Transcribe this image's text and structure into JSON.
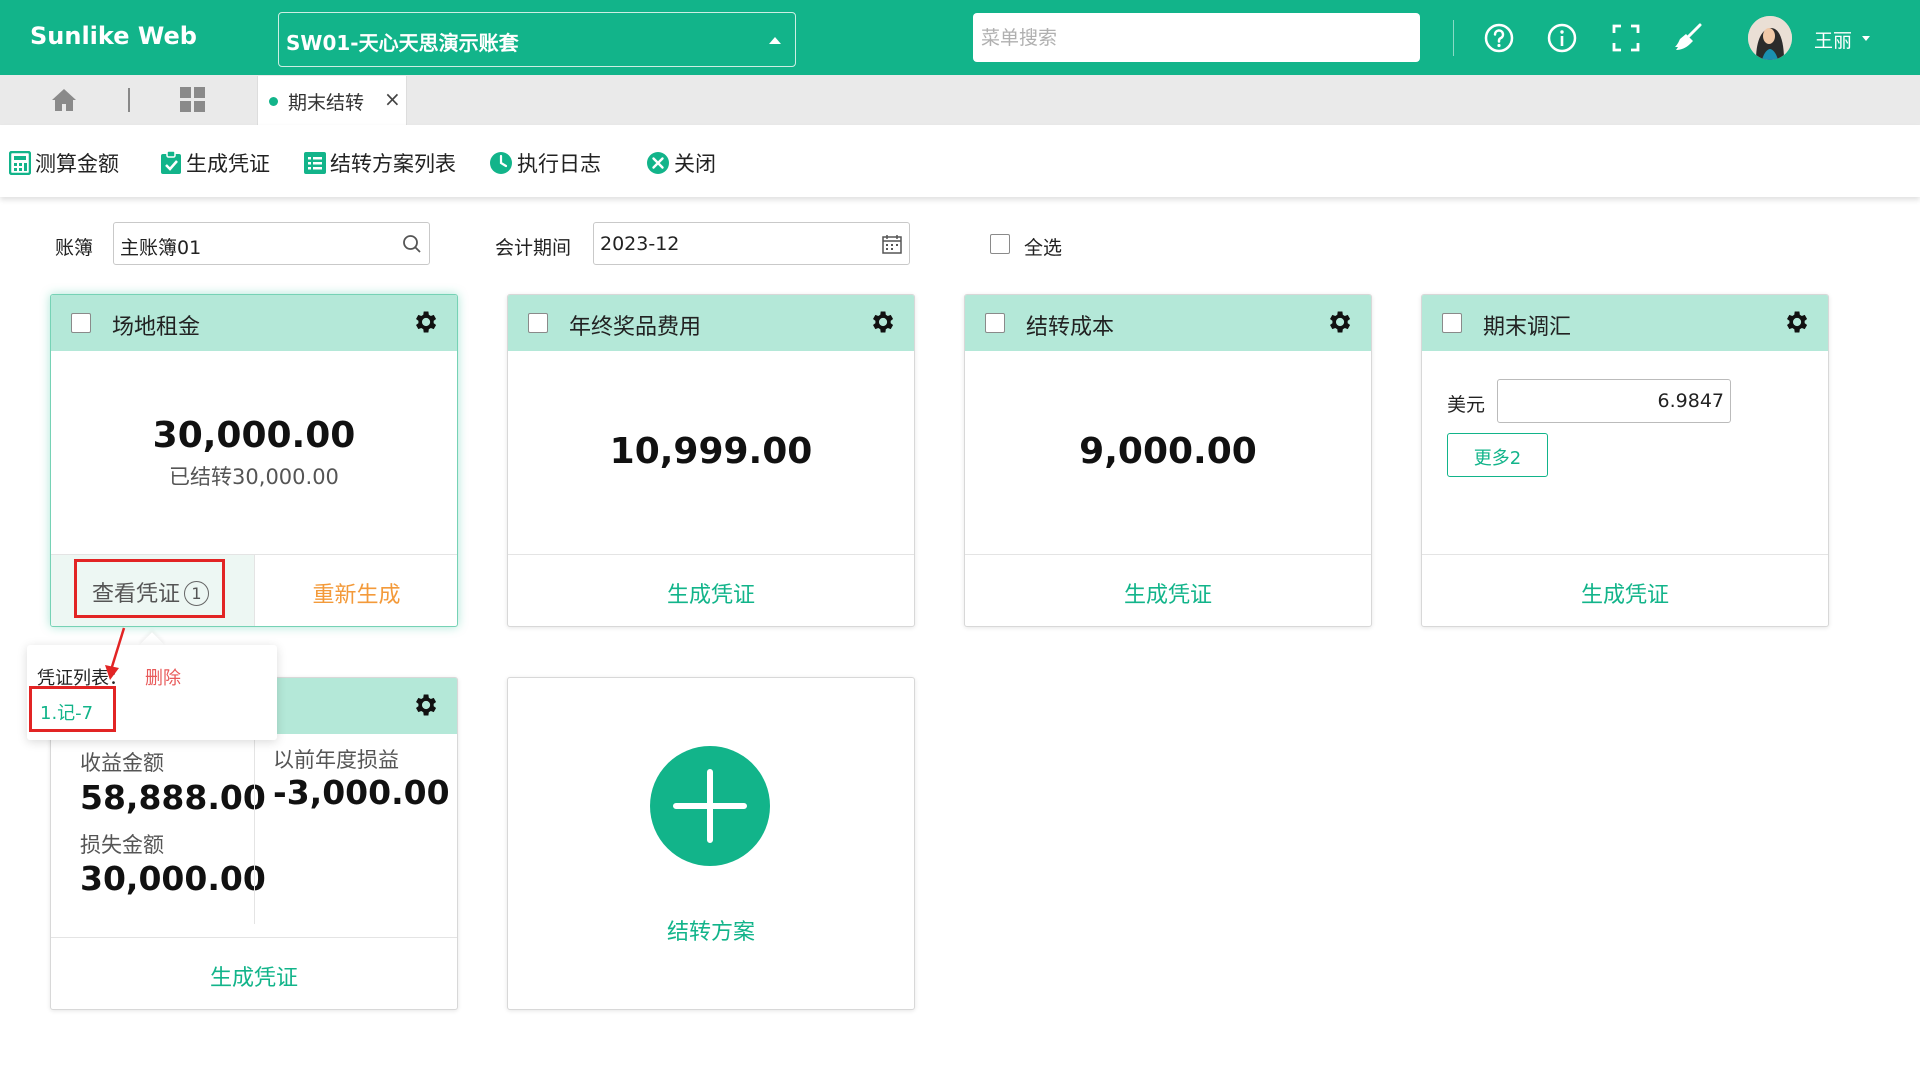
{
  "app": {
    "title": "Sunlike Web"
  },
  "header": {
    "account_set": "SW01-天心天思演示账套",
    "search_placeholder": "菜单搜索",
    "user_name": "王丽"
  },
  "tabs": {
    "active_label": "期末结转"
  },
  "toolbar": {
    "calc": "测算金额",
    "generate": "生成凭证",
    "plan_list": "结转方案列表",
    "log": "执行日志",
    "close": "关闭"
  },
  "filters": {
    "ledger_label": "账簿",
    "ledger_value": "主账簿01",
    "period_label": "会计期间",
    "period_value": "2023-12",
    "select_all": "全选"
  },
  "cards": [
    {
      "title": "场地租金",
      "amount": "30,000.00",
      "sub": "已结转30,000.00",
      "view_voucher": "查看凭证",
      "voucher_count": "1",
      "regen": "重新生成"
    },
    {
      "title": "年终奖品费用",
      "amount": "10,999.00",
      "action": "生成凭证"
    },
    {
      "title": "结转成本",
      "amount": "9,000.00",
      "action": "生成凭证"
    },
    {
      "title": "期末调汇",
      "currency_label": "美元",
      "rate": "6.9847",
      "more": "更多2",
      "action": "生成凭证"
    }
  ],
  "profit_card": {
    "income_label": "收益金额",
    "income_value": "58,888.00",
    "loss_label": "损失金额",
    "loss_value": "30,000.00",
    "prior_label": "以前年度损益",
    "prior_value": "-3,000.00",
    "action": "生成凭证"
  },
  "add_card": {
    "label": "结转方案"
  },
  "popover": {
    "label": "凭证列表：",
    "delete": "删除",
    "voucher": "1.记-7"
  },
  "colors": {
    "brand": "#12b48a",
    "card_header": "#b4e8d8",
    "warning": "#f39a3a",
    "danger": "#e22424"
  }
}
